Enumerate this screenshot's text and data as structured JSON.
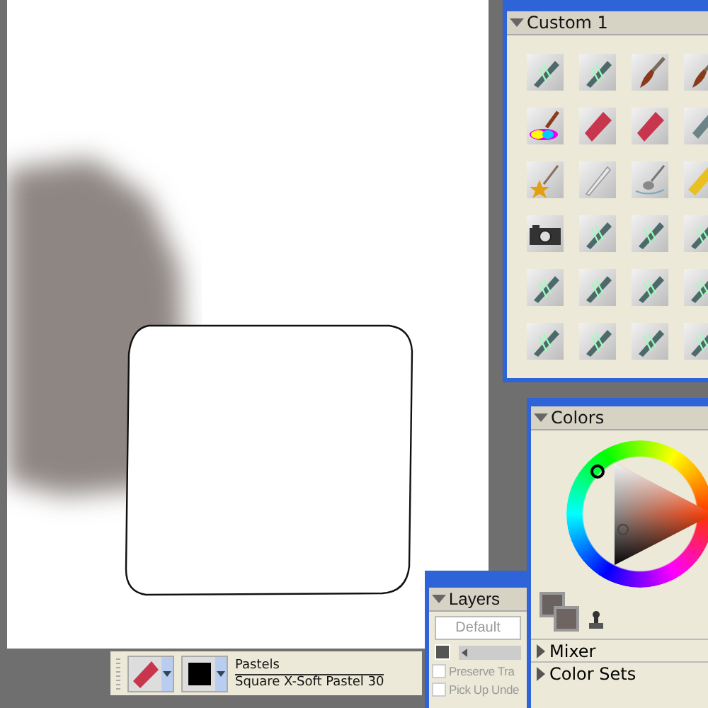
{
  "palette": {
    "title": "Custom  1",
    "expanded": true,
    "tools": [
      {
        "kind": "pen"
      },
      {
        "kind": "pen"
      },
      {
        "kind": "brush"
      },
      {
        "kind": "brush"
      },
      {
        "kind": "colorbrush"
      },
      {
        "kind": "pastel"
      },
      {
        "kind": "pastel"
      },
      {
        "kind": "nib"
      },
      {
        "kind": "star"
      },
      {
        "kind": "stylus"
      },
      {
        "kind": "spoon"
      },
      {
        "kind": "pencil"
      },
      {
        "kind": "camera"
      },
      {
        "kind": "pen"
      },
      {
        "kind": "pen"
      },
      {
        "kind": "pen"
      },
      {
        "kind": "pen"
      },
      {
        "kind": "pen"
      },
      {
        "kind": "pen"
      },
      {
        "kind": "pen"
      },
      {
        "kind": "pen"
      },
      {
        "kind": "pen"
      },
      {
        "kind": "pen"
      },
      {
        "kind": "pen"
      }
    ]
  },
  "colors": {
    "title": "Colors",
    "expanded": true,
    "sections": [
      {
        "label": "Mixer",
        "expanded": false
      },
      {
        "label": "Color Sets",
        "expanded": false
      }
    ]
  },
  "layers": {
    "title": "Layers",
    "expanded": true,
    "composite": "Default",
    "opacity": {
      "level": 0
    },
    "options": [
      {
        "label": "Preserve Tra",
        "checked": false
      },
      {
        "label": "Pick Up Unde",
        "checked": false
      }
    ]
  },
  "property_bar": {
    "category": "Pastels",
    "variant": "Square X-Soft Pastel 30"
  }
}
